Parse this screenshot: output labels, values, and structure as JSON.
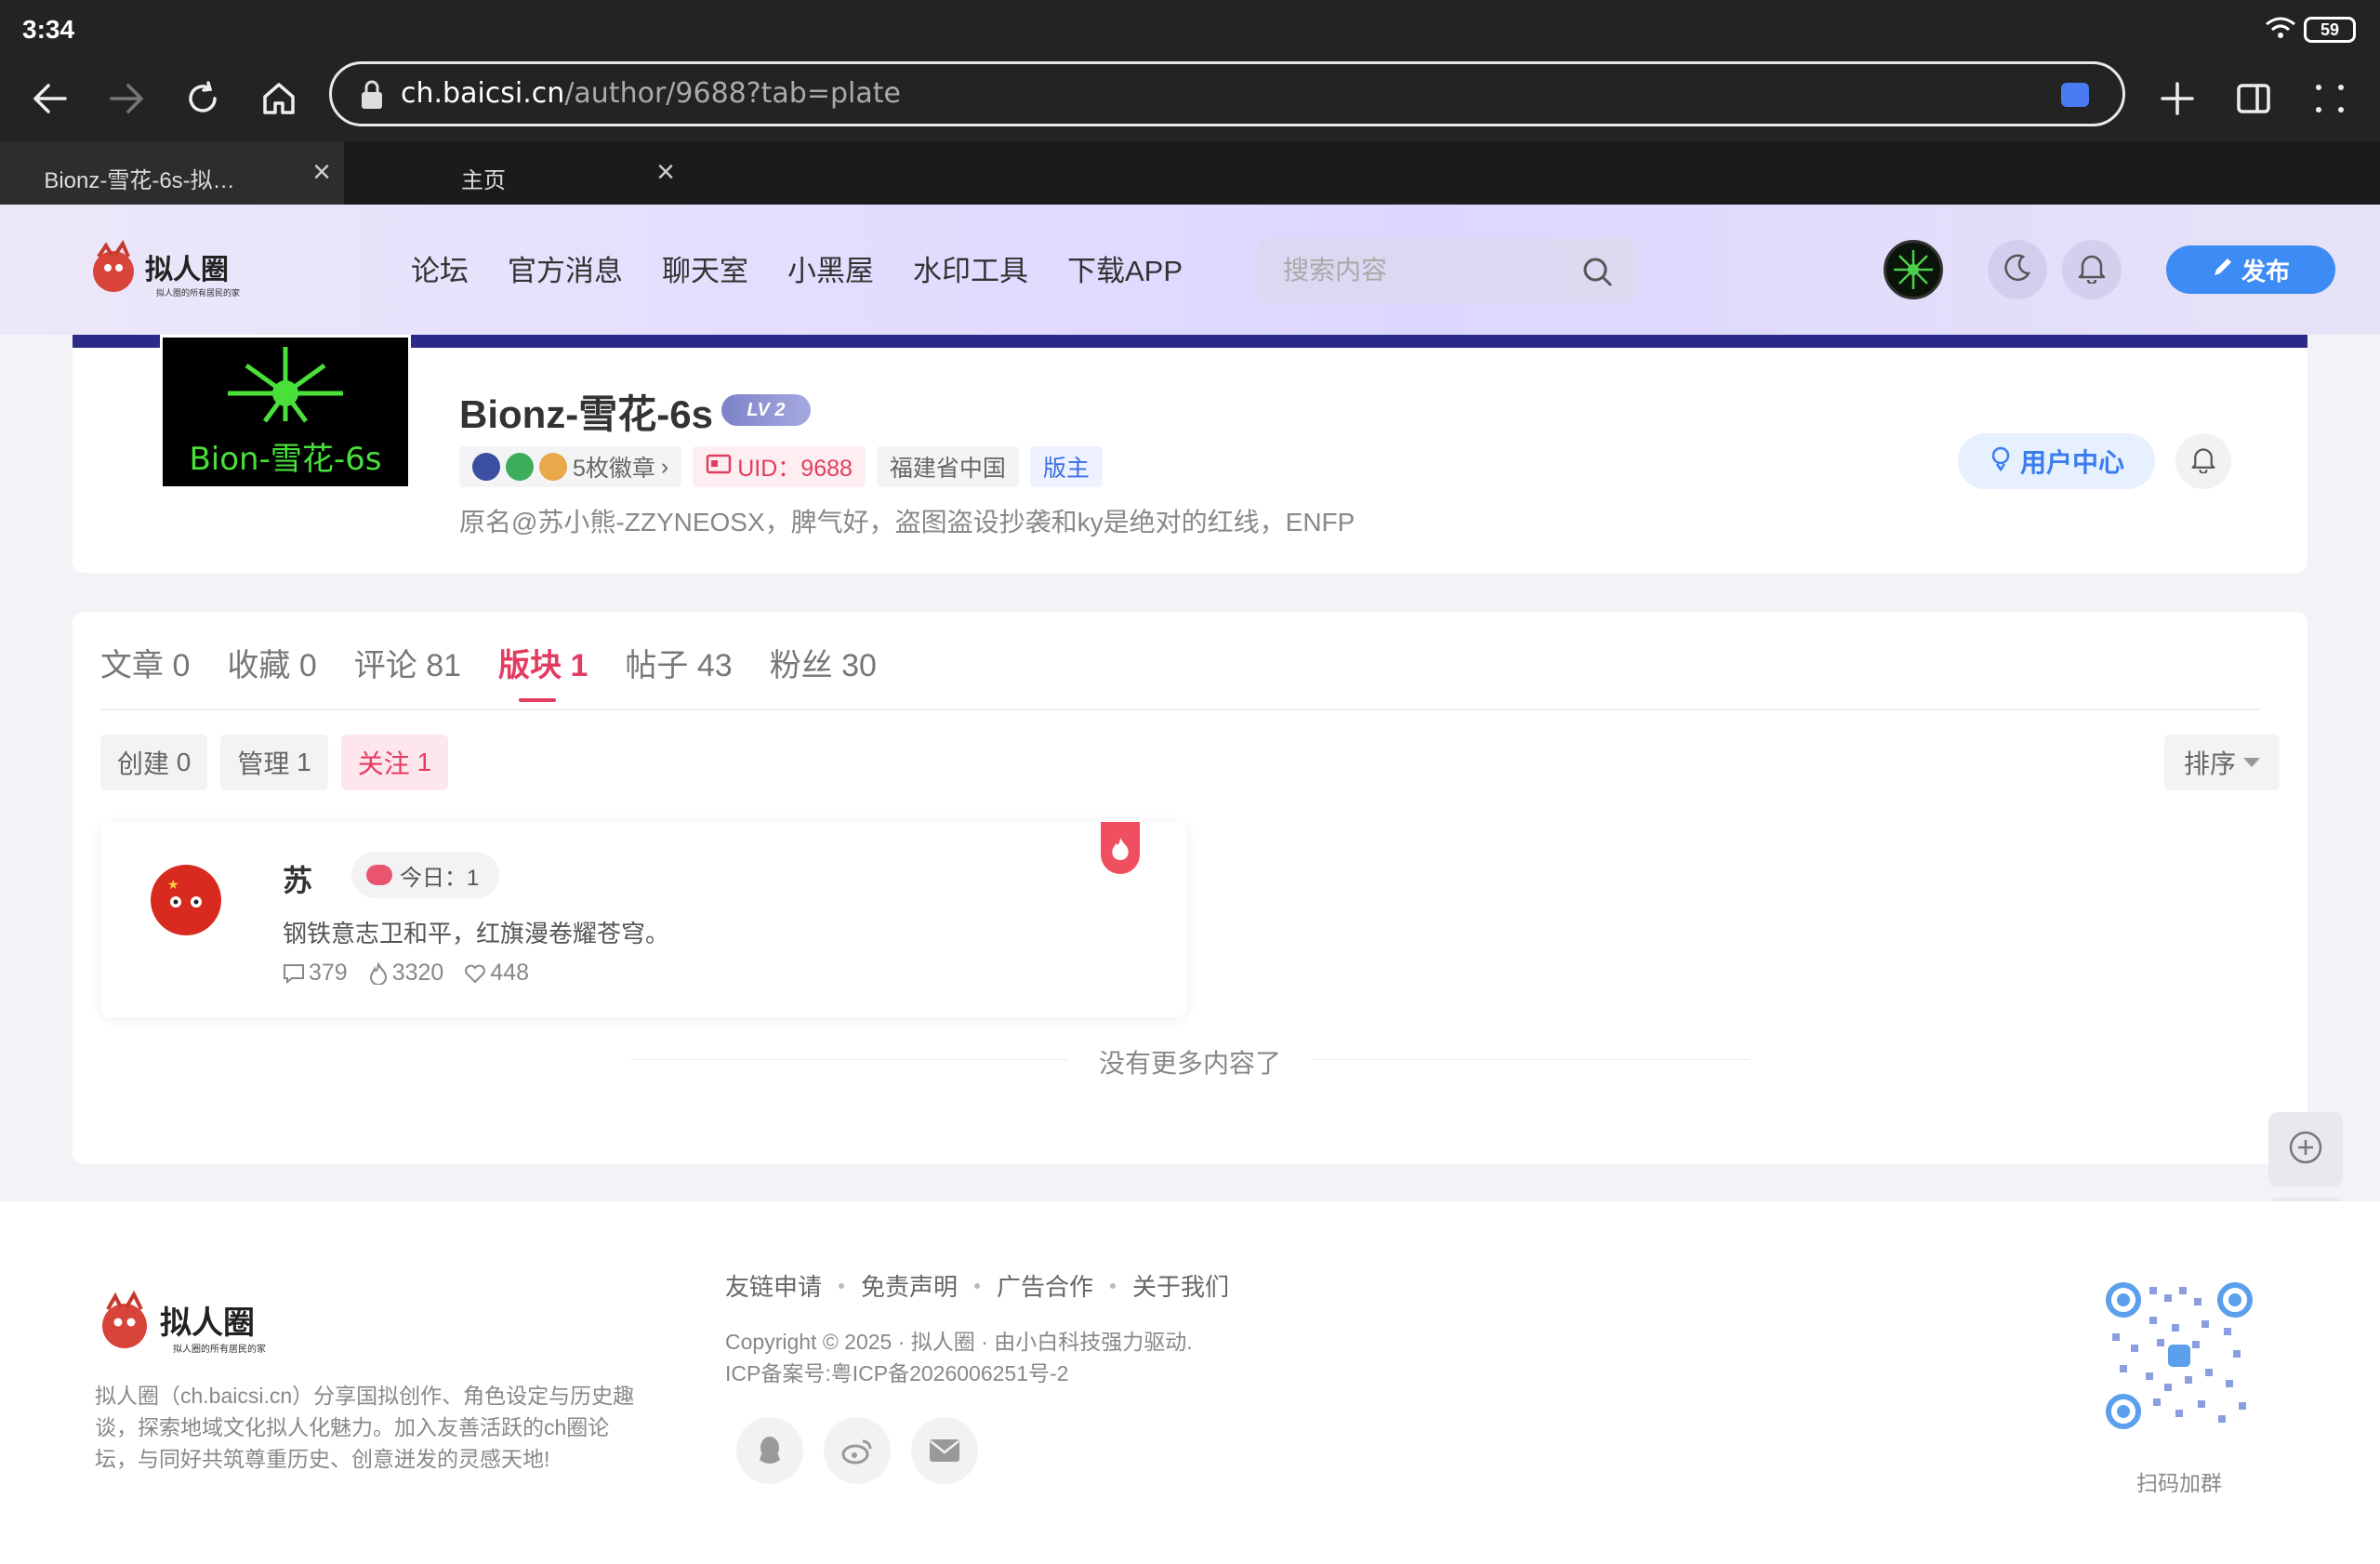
{
  "status": {
    "time": "3:34",
    "battery": "59"
  },
  "browser": {
    "url_host": "ch.baicsi.cn",
    "url_path": "/author/9688?tab=plate",
    "tabs": [
      {
        "label": "Bionz-雪花-6s-拟…",
        "active": true
      },
      {
        "label": "主页",
        "active": false
      }
    ]
  },
  "header": {
    "nav": [
      "论坛",
      "官方消息",
      "聊天室",
      "小黑屋",
      "水印工具",
      "下载APP"
    ],
    "search_placeholder": "搜索内容",
    "publish_label": "发布"
  },
  "profile": {
    "name": "Bionz-雪花-6s",
    "level": "LV 2",
    "badges_label": "5枚徽章",
    "uid": "UID：9688",
    "location": "福建省中国",
    "role": "版主",
    "bio": "原名@苏小熊-ZZYNEOSX，脾气好，盗图盗设抄袭和ky是绝对的红线，ENFP",
    "user_center_label": "用户中心",
    "avatar_text": "Bion-雪花-6s"
  },
  "tabs": [
    {
      "label": "文章",
      "count": "0"
    },
    {
      "label": "收藏",
      "count": "0"
    },
    {
      "label": "评论",
      "count": "81"
    },
    {
      "label": "版块",
      "count": "1",
      "active": true
    },
    {
      "label": "帖子",
      "count": "43"
    },
    {
      "label": "粉丝",
      "count": "30"
    }
  ],
  "subtabs": [
    {
      "label": "创建",
      "count": "0"
    },
    {
      "label": "管理",
      "count": "1"
    },
    {
      "label": "关注",
      "count": "1",
      "active": true
    }
  ],
  "sort_label": "排序",
  "plate": {
    "title": "苏",
    "today_label": "今日：1",
    "desc": "钢铁意志卫和平，红旗漫卷耀苍穹。",
    "comments": "379",
    "hot": "3320",
    "likes": "448"
  },
  "no_more": "没有更多内容了",
  "footer": {
    "about": "拟人圈（ch.baicsi.cn）分享国拟创作、角色设定与历史趣谈，探索地域文化拟人化魅力。加入友善活跃的ch圈论坛，与同好共筑尊重历史、创意迸发的灵感天地!",
    "links": [
      "友链申请",
      "免责声明",
      "广告合作",
      "关于我们"
    ],
    "copyright": "Copyright © 2025 · 拟人圈 · 由小白科技强力驱动.",
    "icp": "ICP备案号:粤ICP备2026006251号-2",
    "qr_label": "扫码加群"
  },
  "colors": {
    "accent": "#e43b61",
    "blue": "#3d8bf5",
    "cover": "#2c2a88"
  }
}
